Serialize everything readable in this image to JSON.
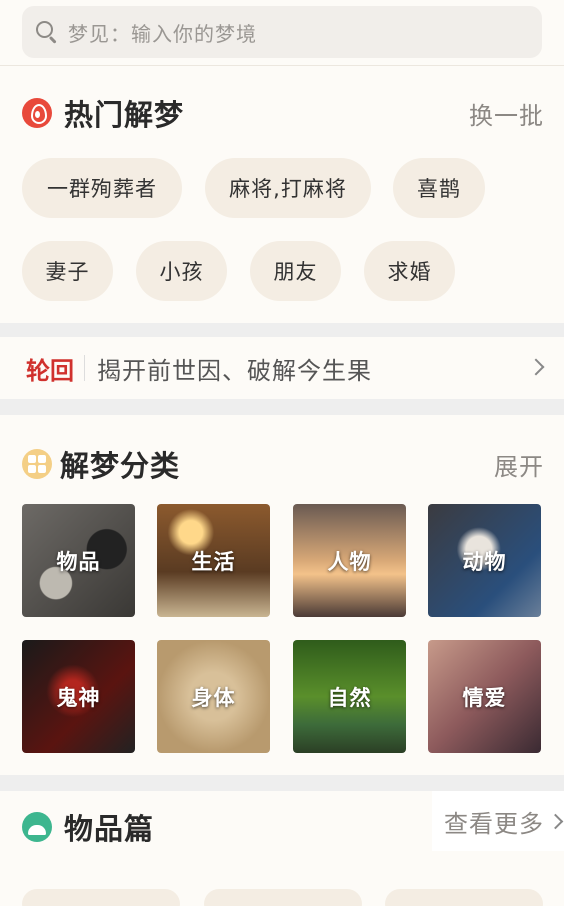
{
  "search": {
    "placeholder": "梦见：输入你的梦境"
  },
  "hot": {
    "title": "热门解梦",
    "action": "换一批",
    "tags": [
      "一群殉葬者",
      "麻将,打麻将",
      "喜鹊",
      "妻子",
      "小孩",
      "朋友",
      "求婚"
    ]
  },
  "reincarnation": {
    "label": "轮回",
    "text": "揭开前世因、破解今生果"
  },
  "categories": {
    "title": "解梦分类",
    "action": "展开",
    "items": [
      "物品",
      "生活",
      "人物",
      "动物",
      "鬼神",
      "身体",
      "自然",
      "情爱"
    ]
  },
  "items_section": {
    "title": "物品篇",
    "action": "查看更多"
  },
  "colors": {
    "accent_red": "#d0312d",
    "tag_bg": "#f4ede3",
    "page_bg": "#fdfbf7",
    "gap_bg": "#eeeeee"
  }
}
